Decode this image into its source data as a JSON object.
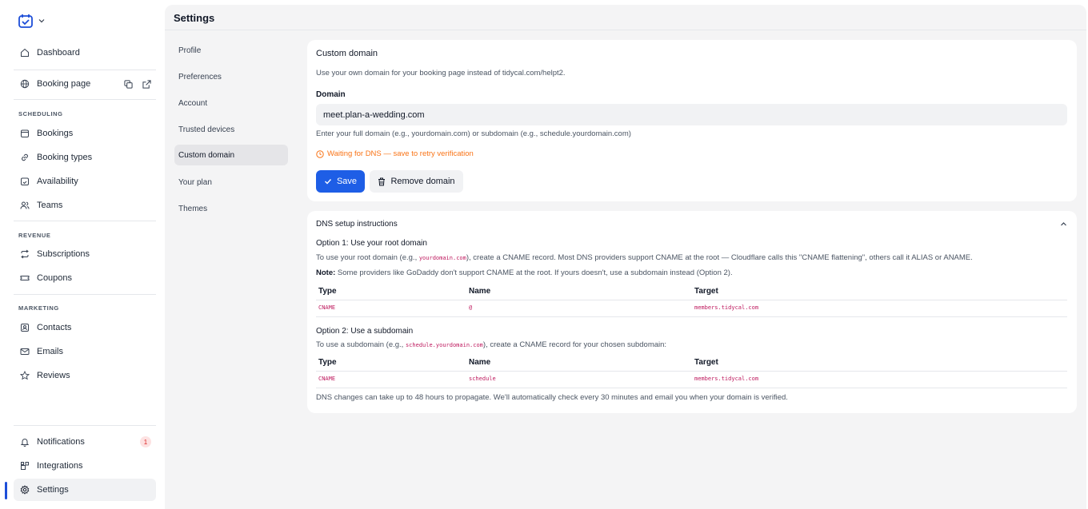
{
  "sidebar": {
    "items_top": [
      {
        "label": "Dashboard",
        "icon": "home-icon"
      },
      {
        "label": "Booking page",
        "icon": "globe-icon"
      }
    ],
    "sections": [
      {
        "label": "SCHEDULING",
        "items": [
          "Bookings",
          "Booking types",
          "Availability",
          "Teams"
        ]
      },
      {
        "label": "REVENUE",
        "items": [
          "Subscriptions",
          "Coupons"
        ]
      },
      {
        "label": "MARKETING",
        "items": [
          "Contacts",
          "Emails",
          "Reviews"
        ]
      }
    ],
    "bottom": [
      {
        "label": "Notifications",
        "badge": "1"
      },
      {
        "label": "Integrations"
      },
      {
        "label": "Settings"
      }
    ]
  },
  "header": {
    "title": "Settings"
  },
  "subnav": [
    "Profile",
    "Preferences",
    "Account",
    "Trusted devices",
    "Custom domain",
    "Your plan",
    "Themes"
  ],
  "custom_domain": {
    "title": "Custom domain",
    "description": "Use your own domain for your booking page instead of tidycal.com/helpt2.",
    "domain_label": "Domain",
    "domain_value": "meet.plan-a-wedding.com",
    "hint": "Enter your full domain (e.g., yourdomain.com) or subdomain (e.g., schedule.yourdomain.com)",
    "status": "Waiting for DNS — save to retry verification",
    "save_label": "Save",
    "remove_label": "Remove domain"
  },
  "dns": {
    "title": "DNS setup instructions",
    "opt1_title": "Option 1: Use your root domain",
    "opt1_text_a": "To use your root domain (e.g., ",
    "opt1_code": "yourdomain.com",
    "opt1_text_b": "), create a CNAME record. Most DNS providers support CNAME at the root — Cloudflare calls this \"CNAME flattening\", others call it ALIAS or ANAME.",
    "note_label": "Note:",
    "note_text": " Some providers like GoDaddy don't support CNAME at the root. If yours doesn't, use a subdomain instead (Option 2).",
    "table_headers": [
      "Type",
      "Name",
      "Target"
    ],
    "opt1_row": [
      "CNAME",
      "@",
      "members.tidycal.com"
    ],
    "opt2_title": "Option 2: Use a subdomain",
    "opt2_text_a": "To use a subdomain (e.g., ",
    "opt2_code": "schedule.yourdomain.com",
    "opt2_text_b": "), create a CNAME record for your chosen subdomain:",
    "opt2_row": [
      "CNAME",
      "schedule",
      "members.tidycal.com"
    ],
    "footer": "DNS changes can take up to 48 hours to propagate. We'll automatically check every 30 minutes and email you when your domain is verified."
  }
}
